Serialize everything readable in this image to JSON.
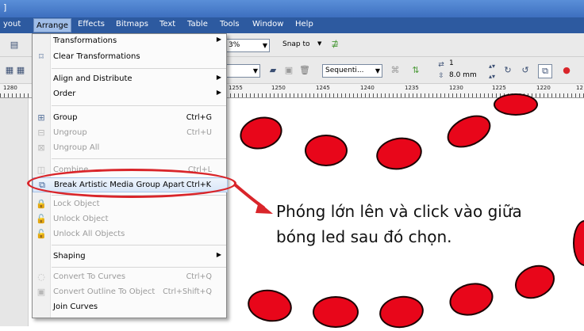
{
  "menubar": {
    "items": [
      {
        "label": "yout"
      },
      {
        "label": "Arrange"
      },
      {
        "label": "Effects"
      },
      {
        "label": "Bitmaps"
      },
      {
        "label": "Text"
      },
      {
        "label": "Table"
      },
      {
        "label": "Tools"
      },
      {
        "label": "Window"
      },
      {
        "label": "Help"
      }
    ]
  },
  "toolbar1": {
    "zoom_value": "3%",
    "snap_to_label": "Snap to"
  },
  "toolbar2": {
    "sequence_value": "Sequenti...",
    "nudge_value": "1",
    "size_value": "8.0 mm"
  },
  "ruler": {
    "labels": [
      "1280",
      "1255",
      "1250",
      "1245",
      "1240",
      "1235",
      "1230",
      "1225",
      "1220",
      "12"
    ]
  },
  "arrange_menu": {
    "items": [
      {
        "label": "Transformations",
        "shortcut": "",
        "submenu": true,
        "enabled": true,
        "icon": ""
      },
      {
        "label": "Clear Transformations",
        "shortcut": "",
        "submenu": false,
        "enabled": true,
        "icon": "clear-transform-icon"
      },
      {
        "label": "Align and Distribute",
        "shortcut": "",
        "submenu": true,
        "enabled": true,
        "icon": ""
      },
      {
        "label": "Order",
        "shortcut": "",
        "submenu": true,
        "enabled": true,
        "icon": ""
      },
      {
        "label": "Group",
        "shortcut": "Ctrl+G",
        "submenu": false,
        "enabled": true,
        "icon": "group-icon"
      },
      {
        "label": "Ungroup",
        "shortcut": "Ctrl+U",
        "submenu": false,
        "enabled": false,
        "icon": "ungroup-icon"
      },
      {
        "label": "Ungroup All",
        "shortcut": "",
        "submenu": false,
        "enabled": false,
        "icon": "ungroup-all-icon"
      },
      {
        "label": "Combine",
        "shortcut": "Ctrl+L",
        "submenu": false,
        "enabled": false,
        "icon": "combine-icon"
      },
      {
        "label": "Break Artistic Media Group Apart",
        "shortcut": "Ctrl+K",
        "submenu": false,
        "enabled": true,
        "icon": "break-apart-icon"
      },
      {
        "label": "Lock Object",
        "shortcut": "",
        "submenu": false,
        "enabled": false,
        "icon": "lock-icon"
      },
      {
        "label": "Unlock Object",
        "shortcut": "",
        "submenu": false,
        "enabled": false,
        "icon": "unlock-icon"
      },
      {
        "label": "Unlock All Objects",
        "shortcut": "",
        "submenu": false,
        "enabled": false,
        "icon": "unlock-all-icon"
      },
      {
        "label": "Shaping",
        "shortcut": "",
        "submenu": true,
        "enabled": true,
        "icon": ""
      },
      {
        "label": "Convert To Curves",
        "shortcut": "Ctrl+Q",
        "submenu": false,
        "enabled": false,
        "icon": "convert-curves-icon"
      },
      {
        "label": "Convert Outline To Object",
        "shortcut": "Ctrl+Shift+Q",
        "submenu": false,
        "enabled": false,
        "icon": "convert-outline-icon"
      },
      {
        "label": "Join Curves",
        "shortcut": "",
        "submenu": false,
        "enabled": true,
        "icon": ""
      }
    ]
  },
  "annotation": {
    "line1": "Phóng lớn lên và click vào giữa",
    "line2": "bóng led sau đó chọn.",
    "highlight_color": "#d9252a"
  },
  "colors": {
    "led_fill": "#e8061a",
    "menubar": "#2d5aa0",
    "titlebar": "#4a7fcc"
  }
}
